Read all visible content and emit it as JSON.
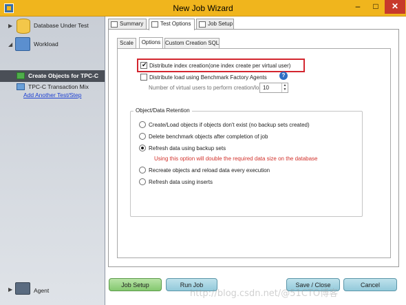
{
  "window": {
    "title": "New Job Wizard",
    "min_label": "–",
    "max_label": "□",
    "close_label": "✕"
  },
  "sidebar": {
    "database_under_test": "Database Under Test",
    "workload": "Workload",
    "create_objects": "Create Objects for TPC-C",
    "tpcc_tx_mix": "TPC-C Transaction Mix",
    "add_test": "Add Another Test/Step",
    "agent": "Agent",
    "arrow_collapsed": "▶",
    "arrow_expanded": "◢"
  },
  "tabs": [
    "Summary",
    "Test Options",
    "Job Setup"
  ],
  "subtabs": [
    "Scale",
    "Options",
    "Custom Creation SQL"
  ],
  "options": {
    "distribute_index": "Distribute index creation(one index create per virtual user)",
    "distribute_index_checked": true,
    "distribute_load": "Distribute load using Benchmark Factory Agents",
    "distribute_load_checked": false,
    "help_glyph": "?",
    "virtual_users_label": "Number of virtual users to perform creation/load:",
    "virtual_users_value": "10"
  },
  "retention": {
    "title": "Object/Data Retention",
    "options": [
      "Create/Load objects if objects don't exist (no backup sets created)",
      "Delete benchmark objects after completion of job",
      "Refresh data using backup sets",
      "Recreate objects and reload data every execution",
      "Refresh data using inserts"
    ],
    "selected_index": 2,
    "warning": "Using this option will double the required data size on the database"
  },
  "footer": {
    "job_setup": "Job Setup",
    "run_job": "Run Job",
    "save_close": "Save / Close",
    "cancel": "Cancel"
  },
  "watermark": "http://blog.csdn.net/@51CTO博客"
}
